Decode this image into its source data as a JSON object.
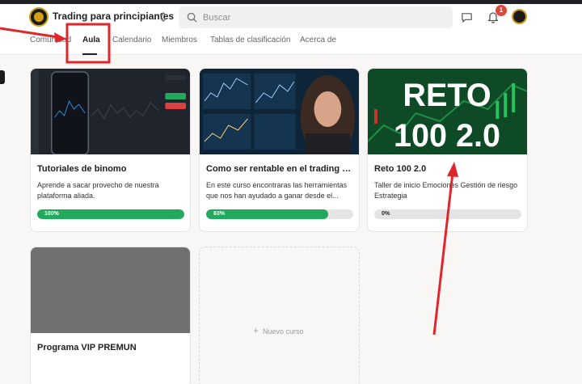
{
  "header": {
    "group_name": "Trading para principiantes",
    "search_placeholder": "Buscar",
    "notification_count": "1"
  },
  "tabs": [
    {
      "label": "Comunidad",
      "active": false
    },
    {
      "label": "Aula",
      "active": true
    },
    {
      "label": "Calendario",
      "active": false
    },
    {
      "label": "Miembros",
      "active": false
    },
    {
      "label": "Tablas de clasificación",
      "active": false
    },
    {
      "label": "Acerca de",
      "active": false
    }
  ],
  "courses": [
    {
      "title": "Tutoriales de binomo",
      "description": "Aprende a sacar provecho de nuestra plataforma aliada.",
      "progress_label": "100%",
      "progress": 100
    },
    {
      "title": "Como ser rentable en el trading d...",
      "description": "En este curso encontraras las herramientas que nos han ayudado a ganar desde el...",
      "progress_label": "83%",
      "progress": 83
    },
    {
      "title": "Reto 100 2.0",
      "image_text_line1": "RETO",
      "image_text_line2": "100 2.0",
      "description": "Taller de inicio Emociones Gestión de riesgo Estrategia",
      "progress_label": "0%",
      "progress": 0
    },
    {
      "title": "Programa VIP PREMUN"
    }
  ],
  "new_course": {
    "label": "Nuevo curso"
  },
  "colors": {
    "progress": "#23a95e",
    "annotation": "#e0262b",
    "badge": "#e0473a",
    "logo_gold": "#d4a017"
  }
}
